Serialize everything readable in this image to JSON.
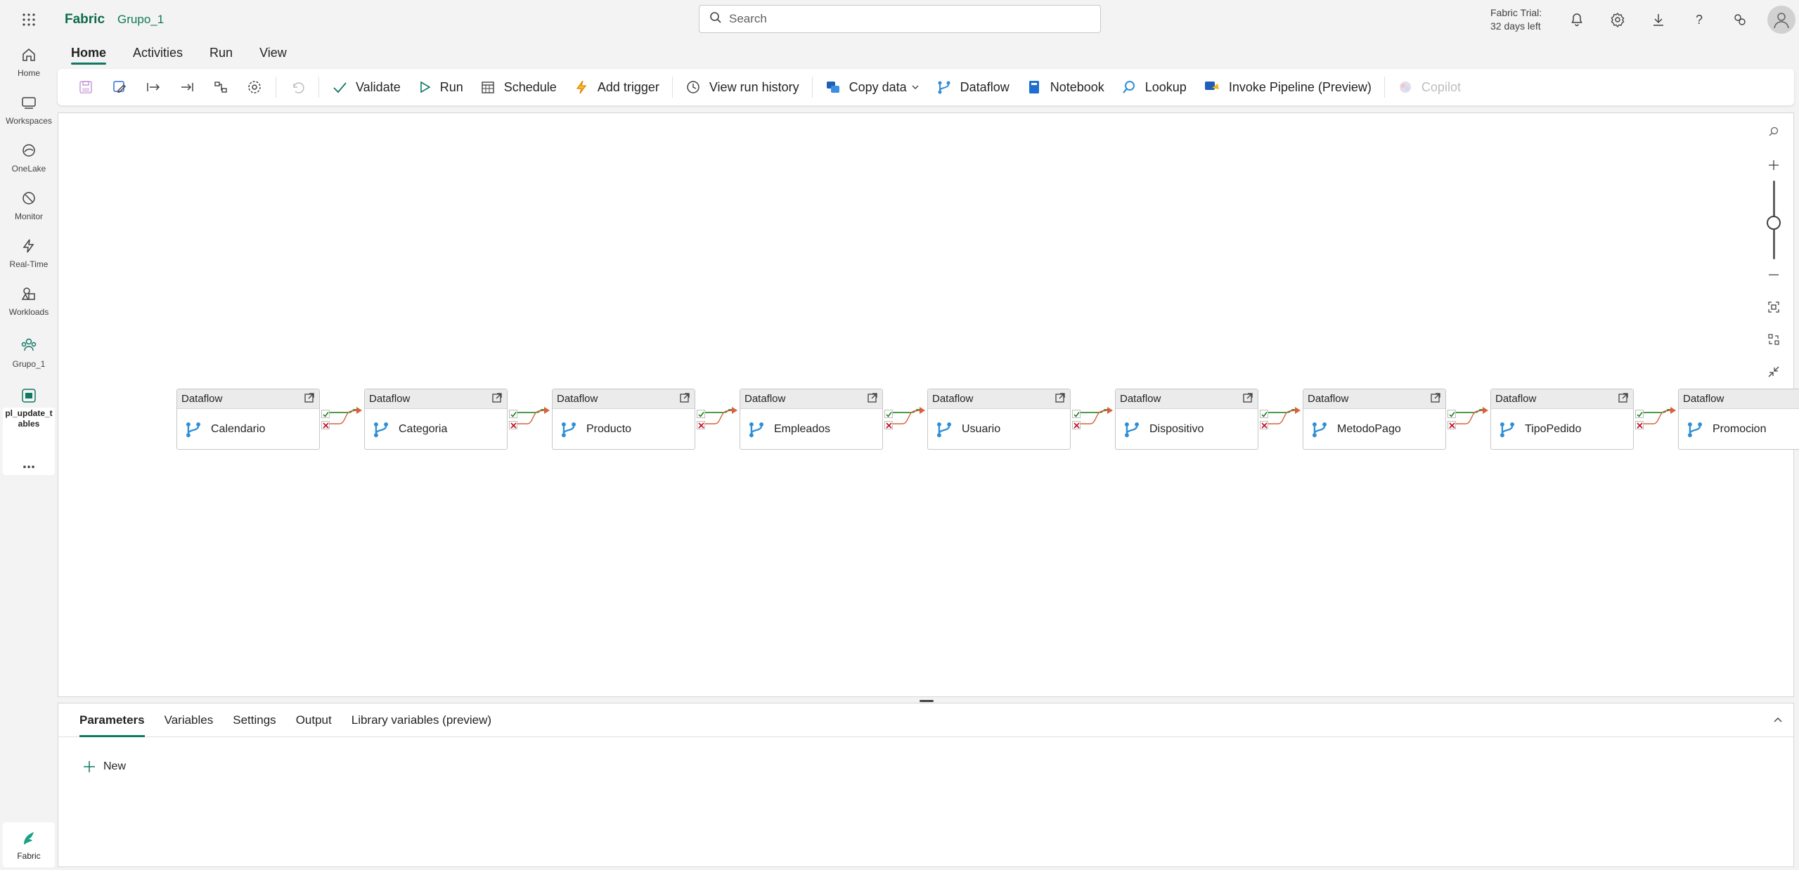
{
  "topbar": {
    "brand": "Fabric",
    "workspace": "Grupo_1",
    "search_placeholder": "Search",
    "trial_line1": "Fabric Trial:",
    "trial_line2": "32 days left",
    "icons": [
      "bell-icon",
      "gear-icon",
      "download-icon",
      "help-icon",
      "share-icon",
      "avatar"
    ]
  },
  "rail": {
    "items": [
      {
        "label": "Home",
        "icon": "home-icon"
      },
      {
        "label": "Workspaces",
        "icon": "workspaces-icon"
      },
      {
        "label": "OneLake",
        "icon": "onelake-icon"
      },
      {
        "label": "Monitor",
        "icon": "monitor-icon"
      },
      {
        "label": "Real-Time",
        "icon": "lightning-icon"
      },
      {
        "label": "Workloads",
        "icon": "workloads-icon"
      },
      {
        "label": "Grupo_1",
        "icon": "group-icon"
      },
      {
        "label": "pl_update_t ables",
        "icon": "pipeline-icon"
      }
    ],
    "more": "...",
    "bottom_label": "Fabric"
  },
  "ribbon": {
    "tabs": [
      "Home",
      "Activities",
      "Run",
      "View"
    ],
    "active_tab": "Home"
  },
  "toolbar": {
    "validate": "Validate",
    "run": "Run",
    "schedule": "Schedule",
    "add_trigger": "Add trigger",
    "view_run_history": "View run history",
    "copy_data": "Copy data",
    "dataflow": "Dataflow",
    "notebook": "Notebook",
    "lookup": "Lookup",
    "invoke_pipeline": "Invoke Pipeline (Preview)",
    "copilot": "Copilot"
  },
  "canvas": {
    "activity_type": "Dataflow",
    "activities": [
      "Calendario",
      "Categoria",
      "Producto",
      "Empleados",
      "Usuario",
      "Dispositivo",
      "MetodoPago",
      "TipoPedido",
      "Promocion"
    ],
    "zoom_level": 0.5
  },
  "bottom_panel": {
    "tabs": [
      "Parameters",
      "Variables",
      "Settings",
      "Output",
      "Library variables (preview)"
    ],
    "active_tab": "Parameters",
    "new_label": "New"
  },
  "colors": {
    "accent": "#117865",
    "brand": "#0e6b4d",
    "success": "#107c10",
    "failure": "#c50f1f",
    "connector": "#d9603b",
    "dataflow_icon": "#2f8fd6"
  }
}
